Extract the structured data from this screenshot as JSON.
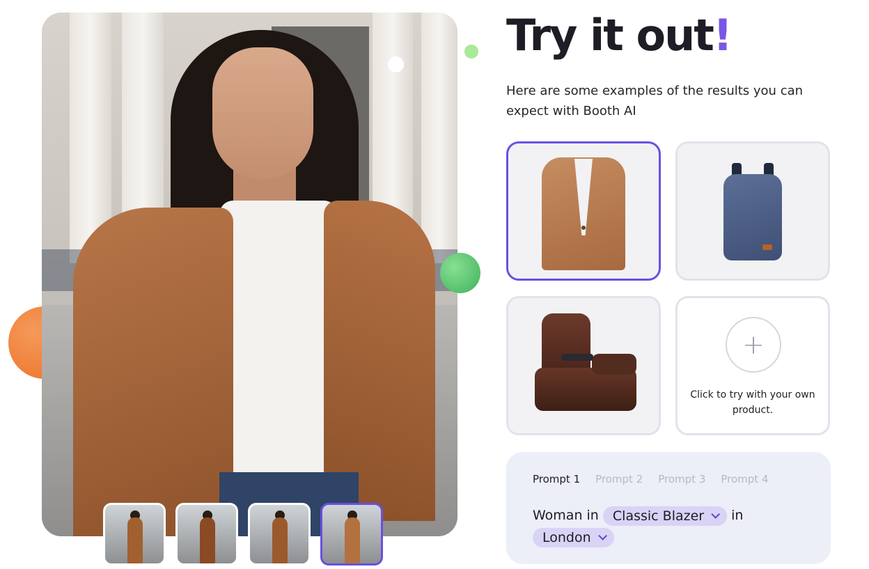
{
  "heading": {
    "text": "Try it out",
    "accent": "!"
  },
  "subtitle": "Here are some examples of the results you can expect with Booth AI",
  "products": [
    {
      "name": "blazer",
      "selected": true
    },
    {
      "name": "backpack",
      "selected": false
    },
    {
      "name": "recliner-chair",
      "selected": false
    }
  ],
  "add_product": {
    "label": "Click to try with your own product."
  },
  "prompt": {
    "tabs": [
      "Prompt 1",
      "Prompt 2",
      "Prompt 3",
      "Prompt 4"
    ],
    "active_tab": 0,
    "prefix": "Woman in",
    "item_option": "Classic Blazer",
    "connector": "in",
    "location_option": "London"
  },
  "thumbnails": {
    "count": 4,
    "active_index": 3
  },
  "colors": {
    "accent": "#7a56e6",
    "selected_border": "#6a50e2",
    "chip_bg": "#d9d3f6",
    "prompt_bg": "#eceef8"
  }
}
